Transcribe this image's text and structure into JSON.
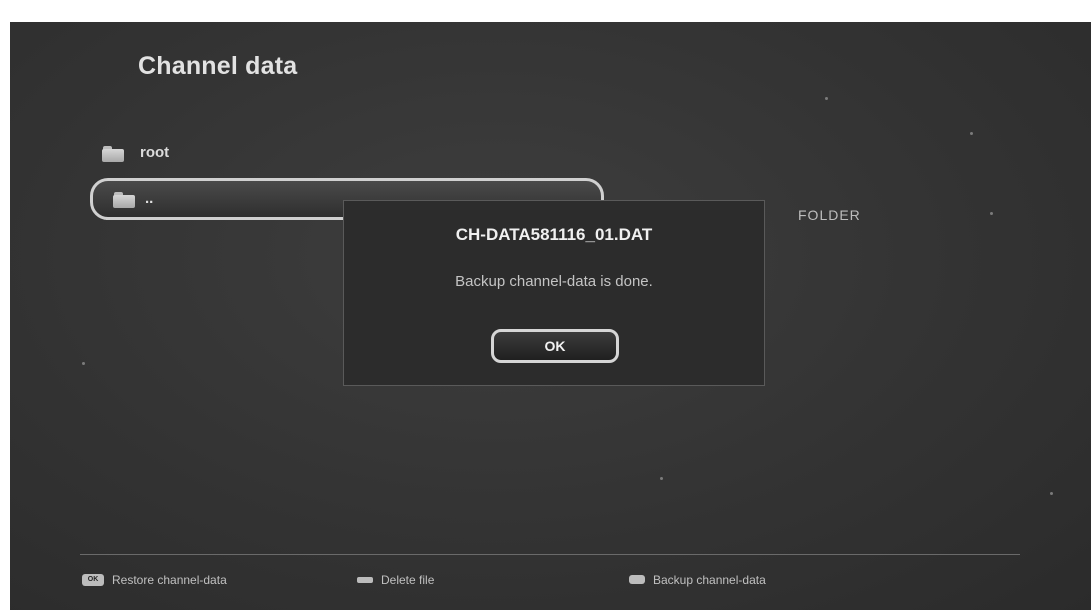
{
  "screen": {
    "title": "Channel data"
  },
  "file_list": {
    "items": [
      {
        "label": "root",
        "icon": "folder-icon"
      },
      {
        "label": "..",
        "icon": "folder-open-icon",
        "selected": true
      }
    ],
    "selected_type": "FOLDER"
  },
  "dialog": {
    "filename": "CH-DATA581116_01.DAT",
    "message": "Backup channel-data is done.",
    "ok_label": "OK"
  },
  "footer": {
    "restore": {
      "key_label": "OK",
      "label": "Restore channel-data",
      "icon": "ok-key-icon"
    },
    "delete": {
      "label": "Delete file",
      "icon": "minus-key-icon"
    },
    "backup": {
      "label": "Backup channel-data",
      "icon": "color-key-icon"
    }
  }
}
